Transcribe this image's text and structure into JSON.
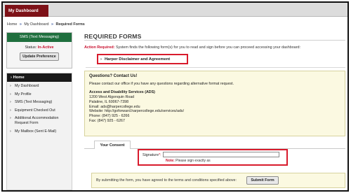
{
  "topbar": {
    "dashboard_tab": "My Dashboard"
  },
  "breadcrumb": {
    "home": "Home",
    "dashboard": "My Dashboard",
    "current": "Required Forms",
    "separator": "»"
  },
  "sms": {
    "title": "SMS (Text Messaging)",
    "status_label": "Status:",
    "status_value": "In-Active",
    "update_button": "Update Preference"
  },
  "nav": {
    "header": "Home",
    "chevron": "›",
    "items": [
      {
        "label": "My Dashboard"
      },
      {
        "label": "My Profile"
      },
      {
        "label": "SMS (Text Messaging)"
      },
      {
        "label": "Equipment Checked Out"
      },
      {
        "label": "Additional Accommodation Request Form"
      },
      {
        "label": "My Mailbox (Sent E-Mail)"
      }
    ]
  },
  "main": {
    "title": "REQUIRED FORMS",
    "action_label": "Action Required:",
    "action_text": "System finds the following form(s) for you to read and sign before you can proceed accessing your dashboard:",
    "form_link": "Harper Disclaimer and Agreement"
  },
  "contact": {
    "heading": "Questions? Contact Us!",
    "intro": "Please contact our office if you have any questions regarding alternative format request.",
    "office": "Access and Disability Services (ADS)",
    "address1": "1200 West Algonquin Road",
    "address2": "Palatine, IL 60067-7398",
    "email": "Email: ads@harpercollege.edu",
    "website": "Website: http://goforward.harpercollege.edu/services/ads/",
    "phone": "Phone: (847) 925 - 6266",
    "fax": "Fax: (847) 925 - 6267"
  },
  "consent": {
    "tab": "Your Consent",
    "signature_label": "Signature",
    "required_mark": "*:",
    "note_label": "Note:",
    "note_text": "Please sign exactly as",
    "submit_text": "By submitting the form, you have agreed to the terms and conditions specified above:",
    "submit_button": "Submit Form"
  },
  "colors": {
    "brand": "#7d1117",
    "sms_header": "#1f6f3e",
    "alert_red": "#c8102e",
    "highlight_box": "#d81b2c",
    "info_bg": "#fbf9e1"
  }
}
